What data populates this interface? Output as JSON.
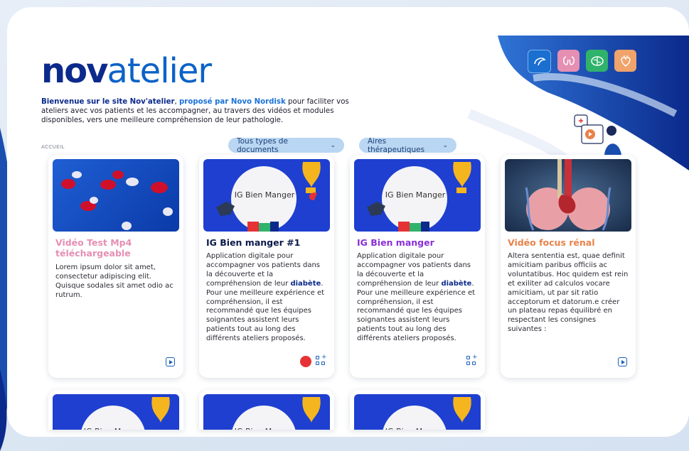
{
  "brand": {
    "logo_part1": "nov",
    "logo_part2": "atelier"
  },
  "intro": {
    "s1": "Bienvenue sur le site Nov'atelier",
    "s2": ", ",
    "s3": "proposé par Novo Nordisk",
    "s4": " pour faciliter vos ateliers avec vos patients et les accompagner, au travers des vidéos et modules disponibles, vers une meilleure compréhension de leur pathologie."
  },
  "breadcrumb": "ACCUEIL",
  "filters": {
    "doc_types": "Tous types de documents",
    "areas": "Aires thérapeutiques"
  },
  "theme_icons": [
    "pancreas-icon",
    "kidney-icon",
    "brain-icon",
    "heart-icon"
  ],
  "colors": {
    "navy": "#0b2a8c",
    "blue": "#1a72d8",
    "pink": "#e58fb3",
    "purple": "#8a30d8",
    "orange": "#e8824a"
  },
  "cards": [
    {
      "title": "Vidéo Test Mp4 téléchargeable",
      "desc": "Lorem ipsum dolor sit amet, consectetur adipiscing elit. Quisque sodales sit amet odio ac rutrum.",
      "type": "video"
    },
    {
      "title": "IG Bien manger #1",
      "desc_a": "Application digitale pour accompagner vos patients dans la découverte et la compréhension de leur ",
      "desc_bold": "diabète",
      "desc_b": ". Pour une meilleure expérience et compréhension, il est recommandé que les équipes soignantes assistent leurs patients tout au long des différents ateliers proposés.",
      "type": "module"
    },
    {
      "title": "IG Bien manger",
      "desc_a": "Application digitale pour accompagner vos patients dans la découverte et la compréhension de leur ",
      "desc_bold": "diabète",
      "desc_b": ". Pour une meilleure expérience et compréhension, il est recommandé que les équipes soignantes assistent leurs patients tout au long des différents ateliers proposés.",
      "type": "module"
    },
    {
      "title": "Vidéo focus rénal",
      "desc": "Altera sententia est, quae definit amicitiam paribus officiis ac voluntatibus. Hoc quidem est rein et exiliter ad calculos vocare amicitiam, ut par sit ratio acceptorum et datorum.e créer un plateau repas équilibré en respectant les consignes suivantes :",
      "type": "video"
    }
  ],
  "thumb_label": "IG Bien Manger"
}
